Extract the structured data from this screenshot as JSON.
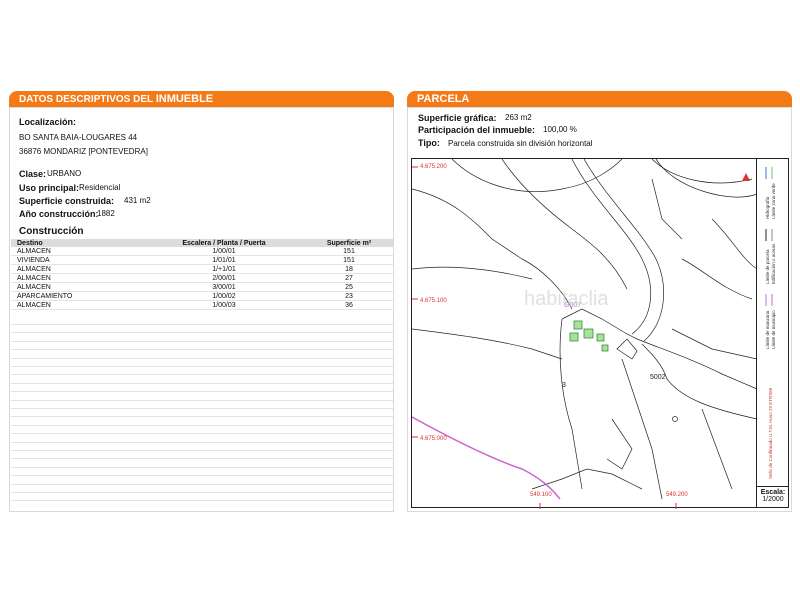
{
  "left_panel": {
    "header_prefix": "DATOS DESCRIPTIVOS DEL ",
    "header_strong": "INMUEBLE",
    "localizacion_label": "Localización:",
    "address_line1": "BO SANTA BAIA-LOUGARES 44",
    "address_line2": "36876 MONDARIZ [PONTEVEDRA]",
    "clase_label": "Clase:",
    "clase_value": "URBANO",
    "uso_label": "Uso principal:",
    "uso_value": "Residencial",
    "superficie_label": "Superficie construida:",
    "superficie_value": "431 m2",
    "anio_label": "Año construcción:",
    "anio_value": "1882",
    "construccion_title": "Construcción",
    "table": {
      "headers": [
        "Destino",
        "Escalera / Planta / Puerta",
        "Superficie m²"
      ],
      "rows": [
        [
          "ALMACEN",
          "1/00/01",
          "151"
        ],
        [
          "VIVIENDA",
          "1/01/01",
          "151"
        ],
        [
          "ALMACEN",
          "1/+1/01",
          "18"
        ],
        [
          "ALMACEN",
          "2/00/01",
          "27"
        ],
        [
          "ALMACEN",
          "3/00/01",
          "25"
        ],
        [
          "APARCAMIENTO",
          "1/00/02",
          "23"
        ],
        [
          "ALMACEN",
          "1/00/03",
          "36"
        ]
      ]
    }
  },
  "right_panel": {
    "header": "PARCELA",
    "superficie_grafica_label": "Superficie gráfica:",
    "superficie_grafica_value": "263 m2",
    "participacion_label": "Participación del inmueble:",
    "participacion_value": "100,00 %",
    "tipo_label": "Tipo:",
    "tipo_value": "Parcela construida sin división horizontal"
  },
  "map": {
    "coord_top": "4.675.200",
    "coord_mid": "4.675.100",
    "coord_low": "4.675.000",
    "coord_bottom_left": "549.100",
    "coord_bottom_right": "549.200",
    "parcel_label": "3",
    "parcel_id_top": "G007",
    "parcel_id_right": "5002",
    "legend_items": [
      "Hidrografía",
      "Límite zona verde",
      "Límite de parcela",
      "Edificación o aceras",
      "Límite de manzana",
      "Límite de municipio"
    ],
    "legend_note": "Sello de Confirmado U.T.M. Huso 29 ETRS89",
    "scale_label": "Escala:",
    "scale_value": "1/2000",
    "watermark": "habitaclia"
  }
}
